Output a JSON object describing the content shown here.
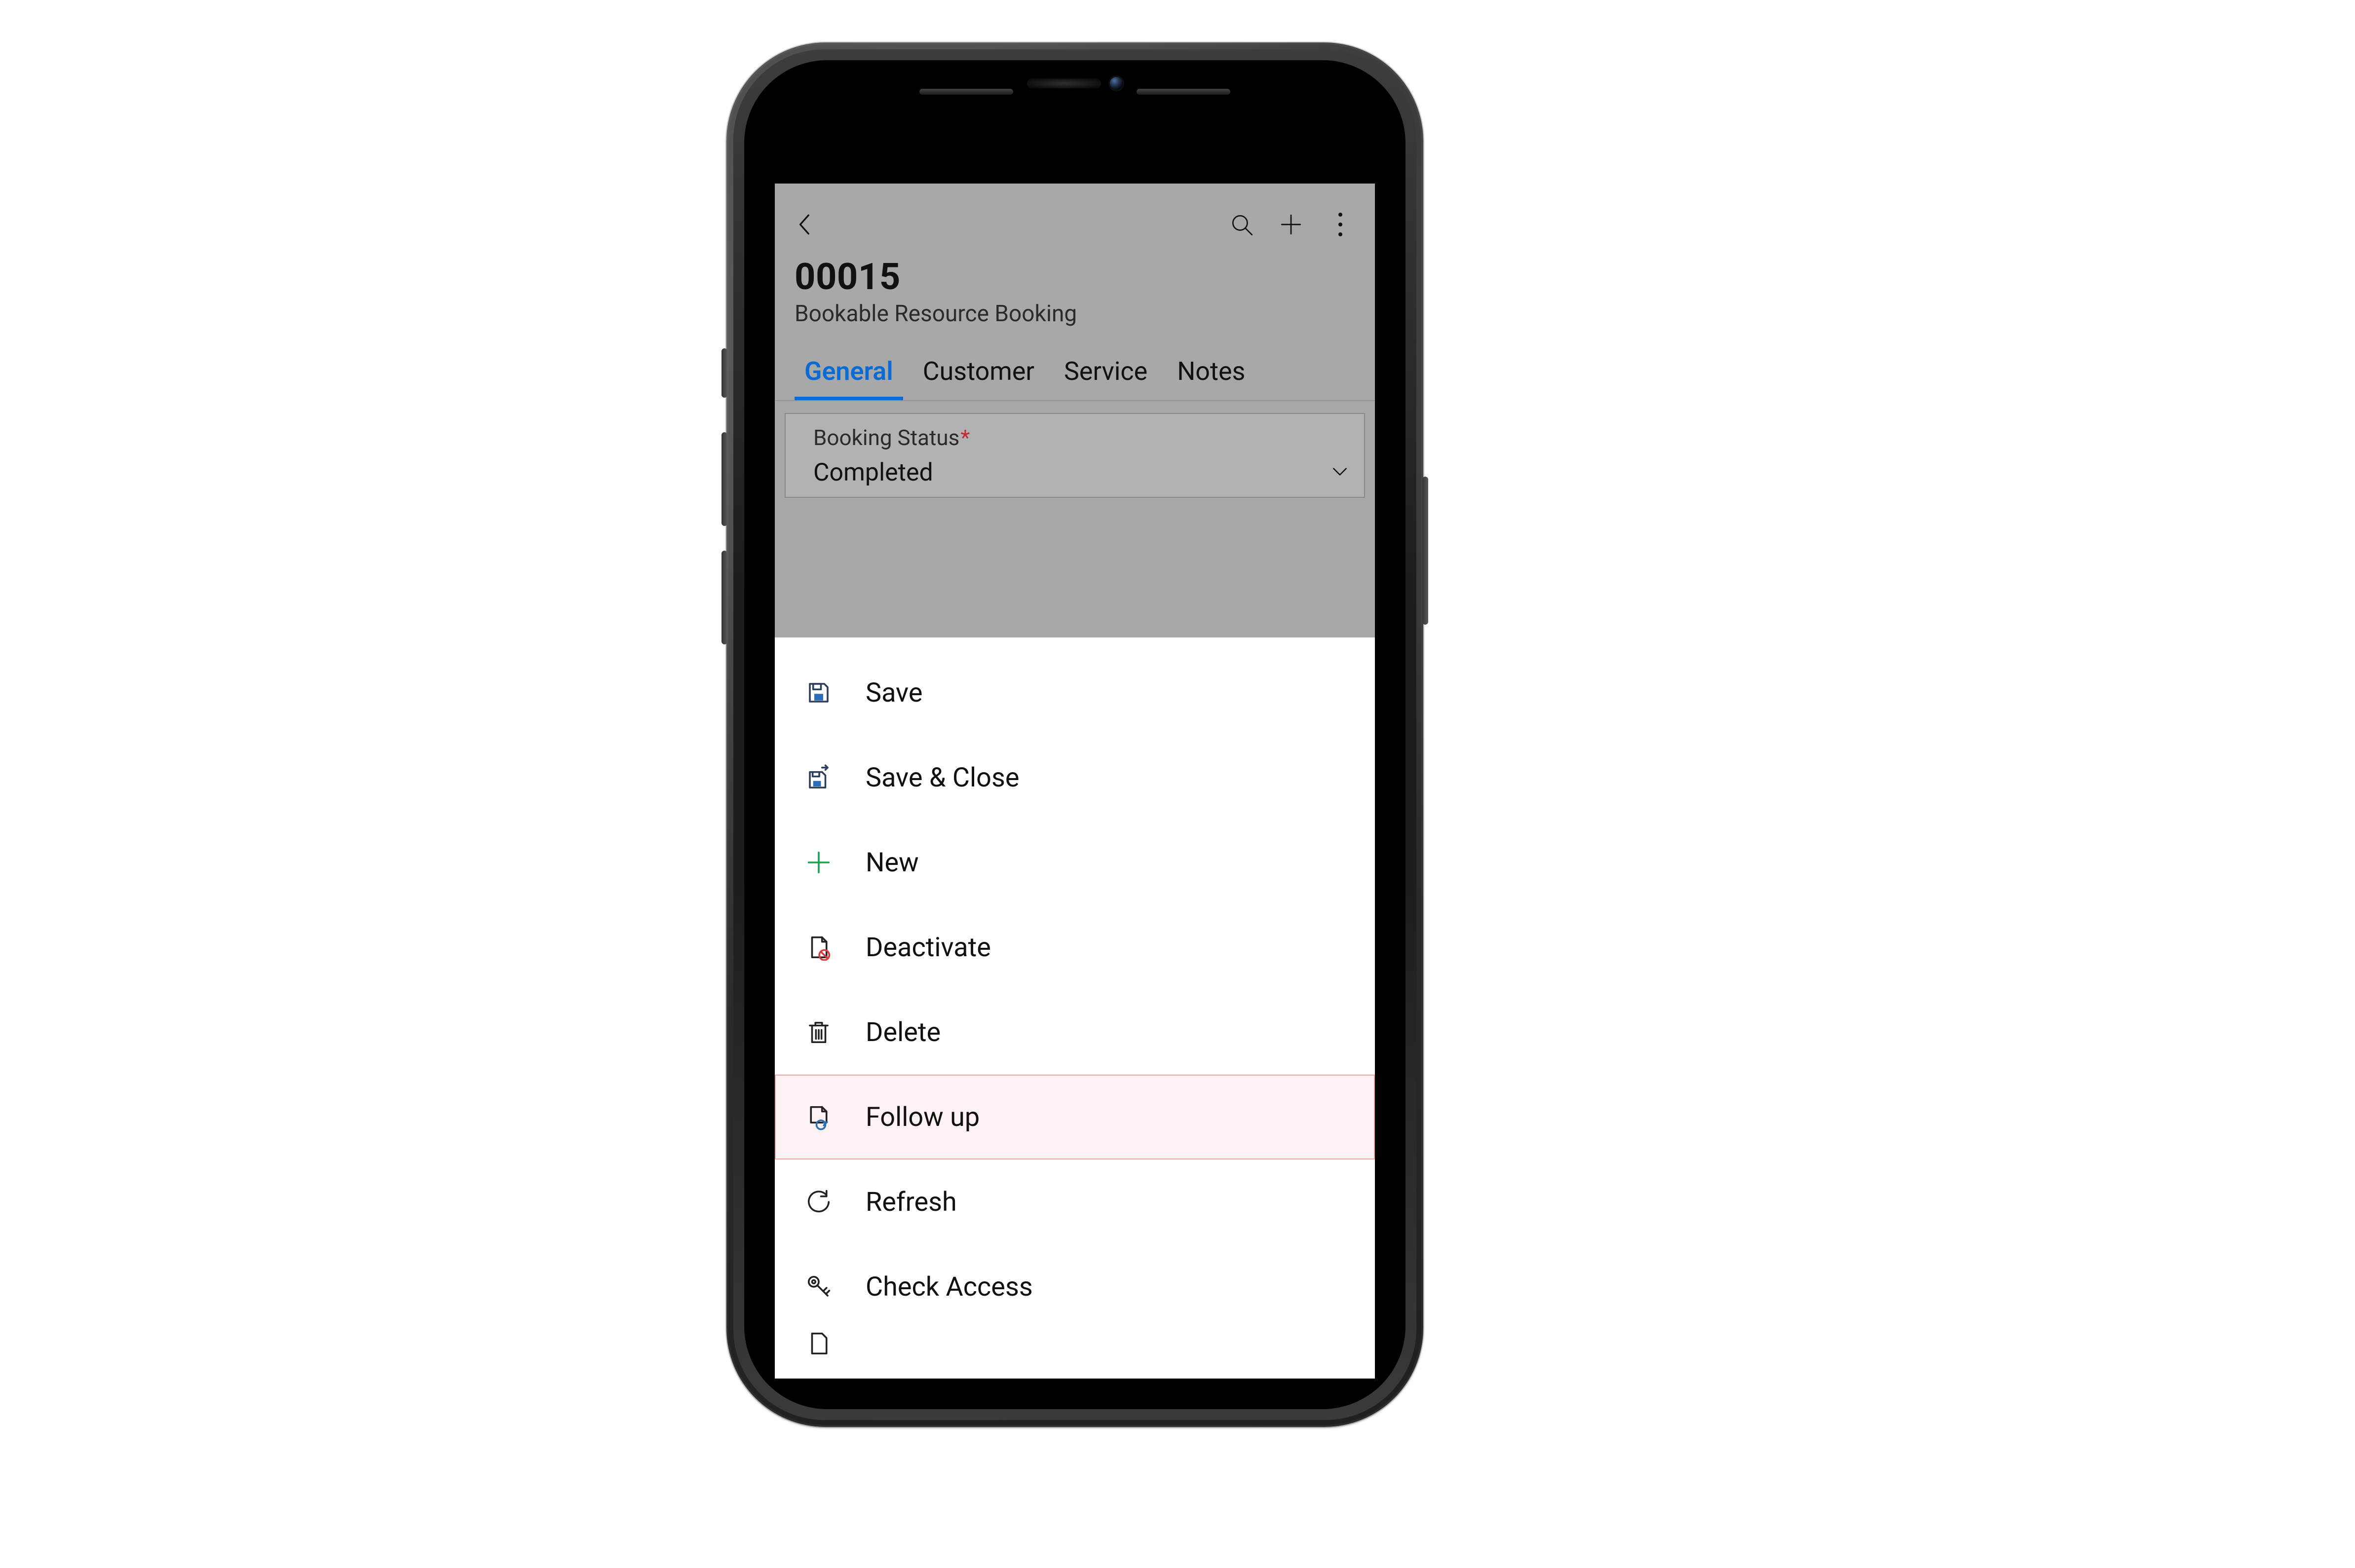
{
  "header": {
    "title": "00015",
    "subtitle": "Bookable Resource Booking"
  },
  "tabs": [
    {
      "label": "General",
      "active": true
    },
    {
      "label": "Customer",
      "active": false
    },
    {
      "label": "Service",
      "active": false
    },
    {
      "label": "Notes",
      "active": false
    }
  ],
  "field": {
    "label": "Booking Status",
    "required_marker": "*",
    "value": "Completed"
  },
  "menu": {
    "save": "Save",
    "save_close": "Save & Close",
    "new": "New",
    "deactivate": "Deactivate",
    "delete": "Delete",
    "follow_up": "Follow up",
    "refresh": "Refresh",
    "check_access": "Check Access"
  }
}
